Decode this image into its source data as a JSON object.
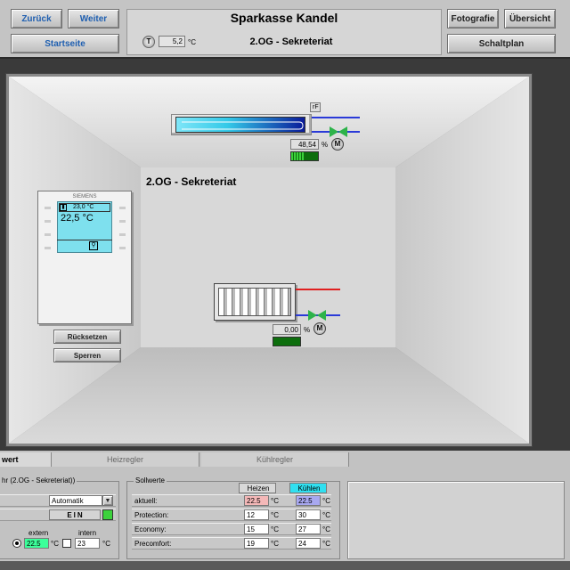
{
  "header": {
    "back_label": "Zurück",
    "forward_label": "Weiter",
    "home_label": "Startseite",
    "title": "Sparkasse Kandel",
    "subtitle": "2.OG - Sekreteriat",
    "temp_icon": "T",
    "outdoor_temp": "5,2",
    "temp_unit": "°C",
    "photo_label": "Fotografie",
    "overview_label": "Übersicht",
    "plan_label": "Schaltplan"
  },
  "room": {
    "title": "2.OG - Sekreteriat",
    "cooler_value": "48,54",
    "cooler_unit": "%",
    "cooler_flag": "rF",
    "motor_label": "M",
    "heater_value": "0,00",
    "heater_unit": "%",
    "thermostat": {
      "brand": "SIEMENS",
      "setpoint": "23,0 °C",
      "actual": "22,5 °C"
    },
    "reset_label": "Rücksetzen",
    "lock_label": "Sperren"
  },
  "tabs": {
    "tab1": "wert",
    "tab2": "Heizregler",
    "tab3": "Kühlregler"
  },
  "left_panel": {
    "title": "hr (2.OG - Sekreteriat))",
    "mode_value": "Automatik",
    "state_value": "EIN",
    "extern_label": "extern",
    "intern_label": "intern",
    "extern_value": "22.5",
    "intern_value": "23",
    "unit": "°C"
  },
  "setpoints": {
    "title": "Sollwerte",
    "heat_label": "Heizen",
    "cool_label": "Kühlen",
    "unit": "°C",
    "rows": [
      {
        "label": "aktuell:",
        "heat": "22.5",
        "cool": "22.5"
      },
      {
        "label": "Protection:",
        "heat": "12",
        "cool": "30"
      },
      {
        "label": "Economy:",
        "heat": "15",
        "cool": "27"
      },
      {
        "label": "Precomfort:",
        "heat": "19",
        "cool": "24"
      }
    ]
  },
  "colors": {
    "cooler": "#33c9e8",
    "heat_highlight": "#f4b8b8",
    "cool_highlight": "#a8a8f0",
    "cool_header": "#30e0f0",
    "extern_value_bg": "#3cff9a",
    "status_green": "#3cd23c"
  }
}
